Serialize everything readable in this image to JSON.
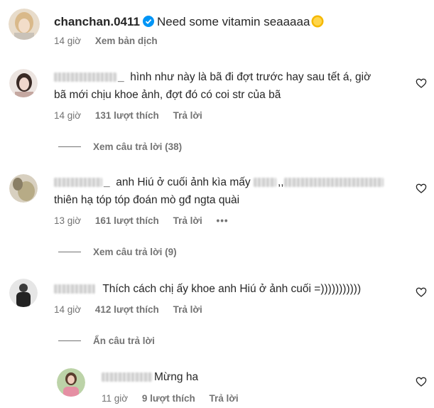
{
  "caption": {
    "username": "chanchan.0411",
    "text": "Need some vitamin seaaaaa",
    "time": "14 giờ",
    "translate": "Xem bản dịch"
  },
  "comments": [
    {
      "user_suffix": "_",
      "line1": "hình như này là bã đi đợt trước hay sau tết á, giờ",
      "line2": "bã mới chịu khoe ảnh, đợt đó có coi str của bã",
      "time": "14 giờ",
      "likes": "131 lượt thích",
      "reply": "Trả lời",
      "view_replies": "Xem câu trả lời (38)"
    },
    {
      "user_suffix": "_",
      "line1": "anh Hiú ở cuối ảnh kìa mấy",
      "line1_tail": ",,",
      "line2": "thiên hạ tóp tóp đoán mò gđ ngta quài",
      "time": "13 giờ",
      "likes": "161 lượt thích",
      "reply": "Trả lời",
      "more": "•••",
      "view_replies": "Xem câu trả lời (9)"
    },
    {
      "line1": "Thích cách chị ấy khoe anh Hiú ở ảnh cuối =)))))))))))",
      "time": "14 giờ",
      "likes": "412 lượt thích",
      "reply": "Trả lời",
      "hide_replies": "Ẩn câu trả lời"
    }
  ],
  "reply": {
    "text": "Mừng ha",
    "time": "11 giờ",
    "likes": "9 lượt thích",
    "reply": "Trả lời"
  },
  "colors": {
    "verified": "#0095f6",
    "muted": "#737373",
    "text": "#262626"
  }
}
